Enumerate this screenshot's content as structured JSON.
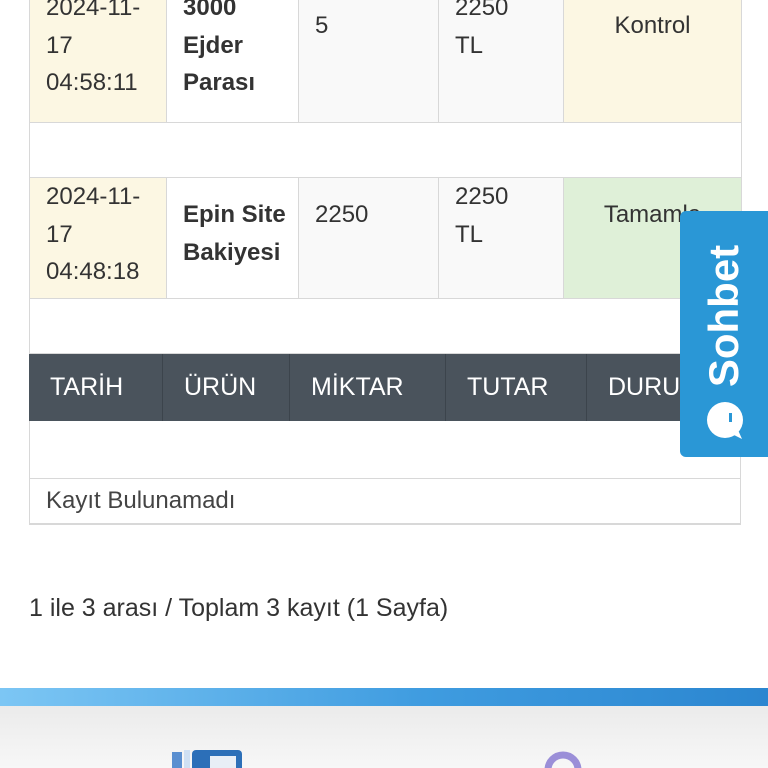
{
  "orders": {
    "rows": [
      {
        "date_line1": "2024-11-",
        "date_line2": "17",
        "date_line3": "04:58:11",
        "product_line1": "3000",
        "product_line2": "Ejder",
        "product_line3": "Parası",
        "quantity": "5",
        "total_line1": "2250",
        "total_line2": "TL",
        "status": "Kontrol"
      },
      {
        "date_line1": "2024-11-",
        "date_line2": "17",
        "date_line3": "04:48:18",
        "product_line1": "Epin Site",
        "product_line2": "Bakiyesi",
        "quantity": "2250",
        "total_line1": "2250",
        "total_line2": "TL",
        "status": "Tamamla"
      }
    ]
  },
  "second_table": {
    "headers": [
      "TARİH",
      "ÜRÜN",
      "MİKTAR",
      "TUTAR",
      "DURU"
    ],
    "empty_message": "Kayıt Bulunamadı"
  },
  "pagination": {
    "info": "1 ile 3 arası / Toplam 3 kayıt (1 Sayfa)"
  },
  "chat": {
    "label": "Sohbet",
    "color": "#2a97d6"
  },
  "colors": {
    "table_header_bg": "#4a535c",
    "warning_bg": "#fcf7e3",
    "success_bg": "#dff0d8"
  },
  "footer": {
    "icons": [
      "wallet-icon",
      "user-icon"
    ]
  }
}
